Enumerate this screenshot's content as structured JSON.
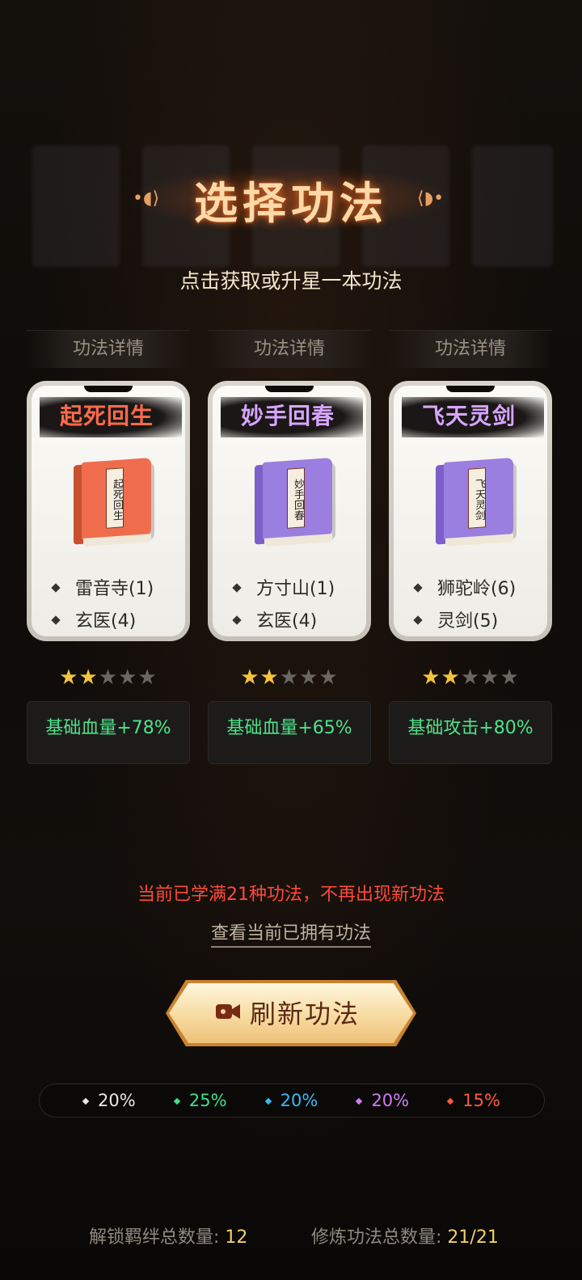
{
  "title": "选择功法",
  "subtitle": "点击获取或升星一本功法",
  "cards": [
    {
      "detail_label": "功法详情",
      "name": "起死回生",
      "name_color": "#ff6a4a",
      "book_color": "#ef6d4d",
      "book_spine": "#c9502f",
      "book_text": "起死回生",
      "attrs": [
        "雷音寺(1)",
        "玄医(4)"
      ],
      "stars": 2,
      "max_stars": 5,
      "bonus": "基础血量+78%"
    },
    {
      "detail_label": "功法详情",
      "name": "妙手回春",
      "name_color": "#d6a6ff",
      "book_color": "#9a7ee0",
      "book_spine": "#7c5fc8",
      "book_text": "妙手回春",
      "attrs": [
        "方寸山(1)",
        "玄医(4)"
      ],
      "stars": 2,
      "max_stars": 5,
      "bonus": "基础血量+65%"
    },
    {
      "detail_label": "功法详情",
      "name": "飞天灵剑",
      "name_color": "#d6a6ff",
      "book_color": "#9a7ee0",
      "book_spine": "#7c5fc8",
      "book_text": "飞天灵剑",
      "attrs": [
        "狮驼岭(6)",
        "灵剑(5)"
      ],
      "stars": 2,
      "max_stars": 5,
      "bonus": "基础攻击+80%"
    }
  ],
  "notice": "当前已学满21种功法，不再出现新功法",
  "view_owned_link": "查看当前已拥有功法",
  "refresh_button": {
    "label": "刷新功法",
    "icon": "video-camera-icon"
  },
  "rates": [
    {
      "value": "20%",
      "color": "#e8e8e8"
    },
    {
      "value": "25%",
      "color": "#3ee08a"
    },
    {
      "value": "20%",
      "color": "#3ab8f0"
    },
    {
      "value": "20%",
      "color": "#d07cf0"
    },
    {
      "value": "15%",
      "color": "#ff5a3c"
    }
  ],
  "footer": {
    "bond_label": "解锁羁绊总数量:",
    "bond_value": "12",
    "skill_label": "修炼功法总数量:",
    "skill_value": "21/21"
  }
}
